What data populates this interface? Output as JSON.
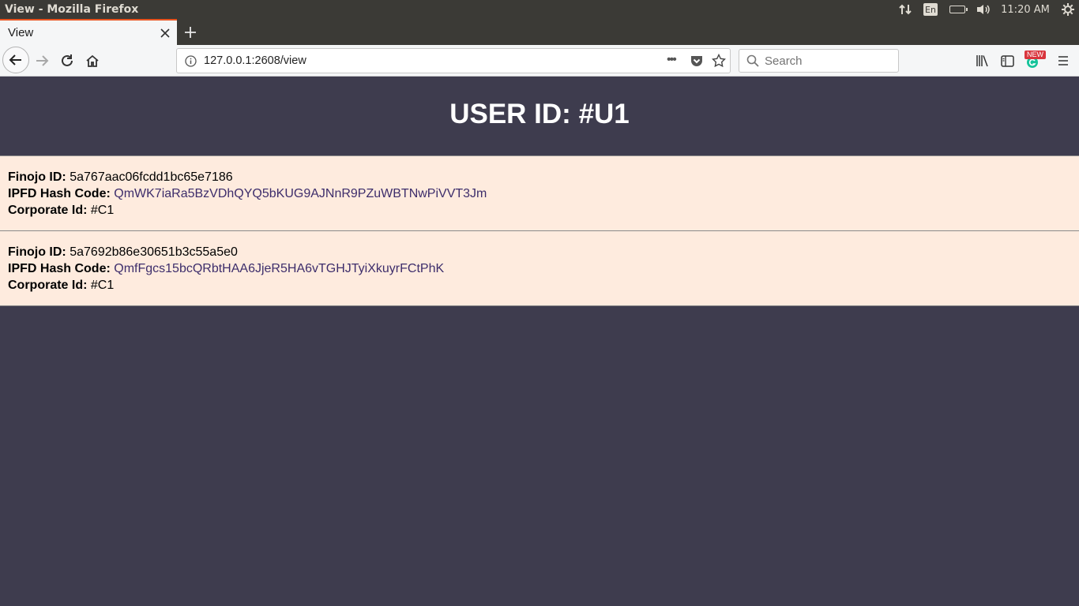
{
  "os": {
    "window_title": "View - Mozilla Firefox",
    "language": "En",
    "time": "11:20 AM"
  },
  "browser": {
    "tab_title": "View",
    "url": "127.0.0.1:2608/view",
    "search_placeholder": "Search",
    "badge": "NEW",
    "more_label": "•••"
  },
  "page": {
    "heading": "USER ID: #U1",
    "labels": {
      "finojo": "Finojo ID:",
      "hash": "IPFD Hash Code:",
      "corporate": "Corporate Id:"
    },
    "records": [
      {
        "finojo_id": "5a767aac06fcdd1bc65e7186",
        "hash_code": "QmWK7iaRa5BzVDhQYQ5bKUG9AJNnR9PZuWBTNwPiVVT3Jm",
        "corporate_id": "#C1"
      },
      {
        "finojo_id": "5a7692b86e30651b3c55a5e0",
        "hash_code": "QmfFgcs15bcQRbtHAA6JjeR5HA6vTGHJTyiXkuyrFCtPhK",
        "corporate_id": "#C1"
      }
    ]
  },
  "colors": {
    "page_bg": "#3e3c4e",
    "record_bg": "#feebde",
    "hash_link": "#3d2d6b",
    "tab_accent": "#e95420"
  }
}
